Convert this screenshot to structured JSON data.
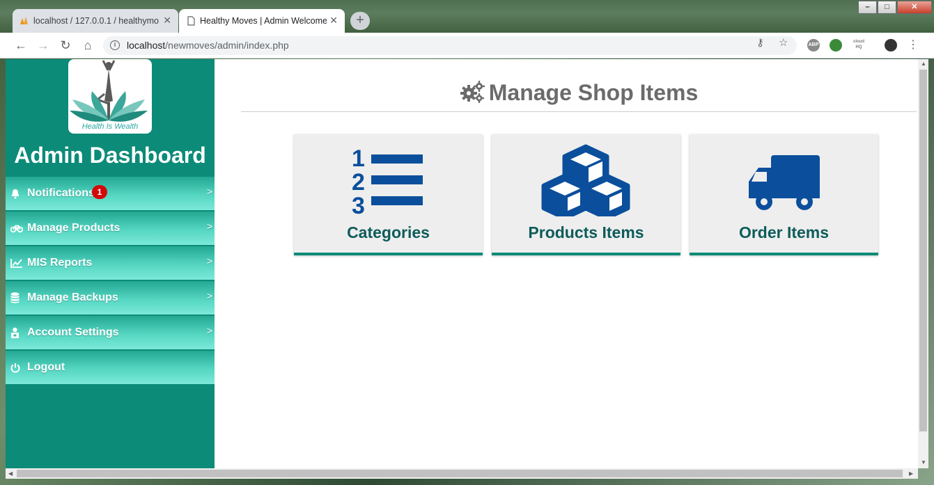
{
  "browser": {
    "tabs": [
      {
        "title": "localhost / 127.0.0.1 / healthymo",
        "active": false,
        "favicon": "phpmyadmin-icon"
      },
      {
        "title": "Healthy Moves | Admin Welcome",
        "active": true,
        "favicon": "page-icon"
      }
    ],
    "url_host": "localhost",
    "url_path": "/newmoves/admin/index.php",
    "extensions": [
      "ABP",
      "cloud HQ"
    ]
  },
  "sidebar": {
    "logo_text": "Health Is Wealth",
    "title": "Admin Dashboard",
    "items": [
      {
        "label": "Notifications",
        "icon": "bell-icon",
        "chevron": ">",
        "badge": "1"
      },
      {
        "label": "Manage Products",
        "icon": "bicycle-icon",
        "chevron": ">"
      },
      {
        "label": "MIS Reports",
        "icon": "line-chart-icon",
        "chevron": ">"
      },
      {
        "label": "Manage Backups",
        "icon": "database-icon",
        "chevron": ">"
      },
      {
        "label": "Account Settings",
        "icon": "user-lock-icon",
        "chevron": ">"
      },
      {
        "label": "Logout",
        "icon": "power-icon",
        "chevron": ""
      }
    ]
  },
  "main": {
    "title": "Manage Shop Items",
    "title_icon": "gears-icon",
    "cards": [
      {
        "label": "Categories",
        "icon": "numbered-list-icon"
      },
      {
        "label": "Products Items",
        "icon": "cubes-icon"
      },
      {
        "label": "Order Items",
        "icon": "truck-icon"
      }
    ]
  },
  "colors": {
    "sidebar_bg": "#0c8b78",
    "icon_blue": "#0b4f9c",
    "card_label": "#0d5c5a",
    "badge_red": "#d20a0a"
  }
}
